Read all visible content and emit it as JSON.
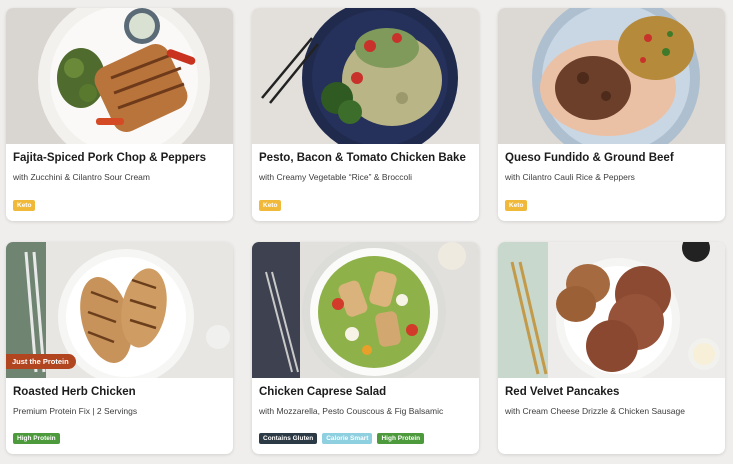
{
  "meals": [
    {
      "title": "Fajita-Spiced Pork Chop & Peppers",
      "subtitle": "with Zucchini & Cilantro Sour Cream",
      "tags": [
        "Keto"
      ]
    },
    {
      "title": "Pesto, Bacon & Tomato Chicken Bake",
      "subtitle": "with Creamy Vegetable “Rice” & Broccoli",
      "tags": [
        "Keto"
      ]
    },
    {
      "title": "Queso Fundido & Ground Beef",
      "subtitle": "with Cilantro Cauli Rice & Peppers",
      "tags": [
        "Keto"
      ]
    },
    {
      "title": "Roasted Herb Chicken",
      "subtitle": "Premium Protein Fix | 2 Servings",
      "tags": [
        "High Protein"
      ],
      "ribbon": "Just the Protein"
    },
    {
      "title": "Chicken Caprese Salad",
      "subtitle": "with Mozzarella, Pesto Couscous & Fig Balsamic",
      "tags": [
        "Contains Gluten",
        "Calorie Smart",
        "High Protein"
      ]
    },
    {
      "title": "Red Velvet Pancakes",
      "subtitle": "with Cream Cheese Drizzle & Chicken Sausage",
      "tags": []
    }
  ],
  "colors": {
    "keto": "#f0b93a",
    "high_protein": "#4c9a3c",
    "contains_gluten": "#2c3a45",
    "calorie_smart": "#8ecfe0",
    "ribbon": "#b1451f"
  }
}
